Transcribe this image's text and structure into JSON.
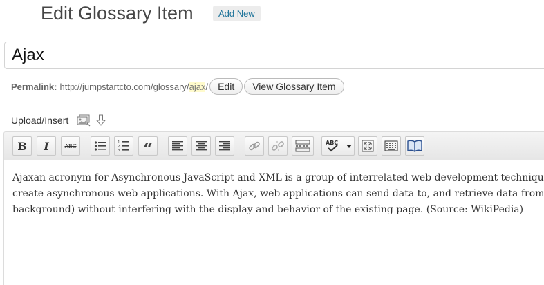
{
  "header": {
    "title": "Edit Glossary Item",
    "add_new_label": "Add New"
  },
  "title_field": {
    "value": "Ajax"
  },
  "permalink": {
    "label": "Permalink:",
    "base_url": "http://jumpstartcto.com/glossary/",
    "slug": "ajax",
    "trailing": "/",
    "edit_label": "Edit",
    "view_label": "View Glossary Item"
  },
  "media": {
    "upload_label": "Upload/Insert",
    "icons": [
      "media-gallery-icon",
      "download-arrow-icon"
    ]
  },
  "toolbar": {
    "bold_label": "B",
    "italic_label": "I",
    "strike_label": "ABC",
    "quote_label": "“",
    "buttons": [
      "bold",
      "italic",
      "strikethrough",
      "bullet-list",
      "numbered-list",
      "blockquote",
      "align-left",
      "align-center",
      "align-right",
      "insert-link",
      "unlink",
      "insert-more",
      "spellcheck",
      "fullscreen",
      "kitchen-sink",
      "dictionary"
    ]
  },
  "editor": {
    "lines": [
      "Ajaxan acronym for Asynchronous JavaScript and XML is a group of interrelated web development techniques",
      "create asynchronous web applications. With Ajax, web applications can send data to, and retrieve data from, a",
      "background) without interfering with the display and behavior of the existing page. (Source: WikiPedia)"
    ]
  },
  "colors": {
    "link": "#21759b",
    "slug_highlight": "#fffbcc",
    "toolbar_bg": "#eeeeee"
  }
}
